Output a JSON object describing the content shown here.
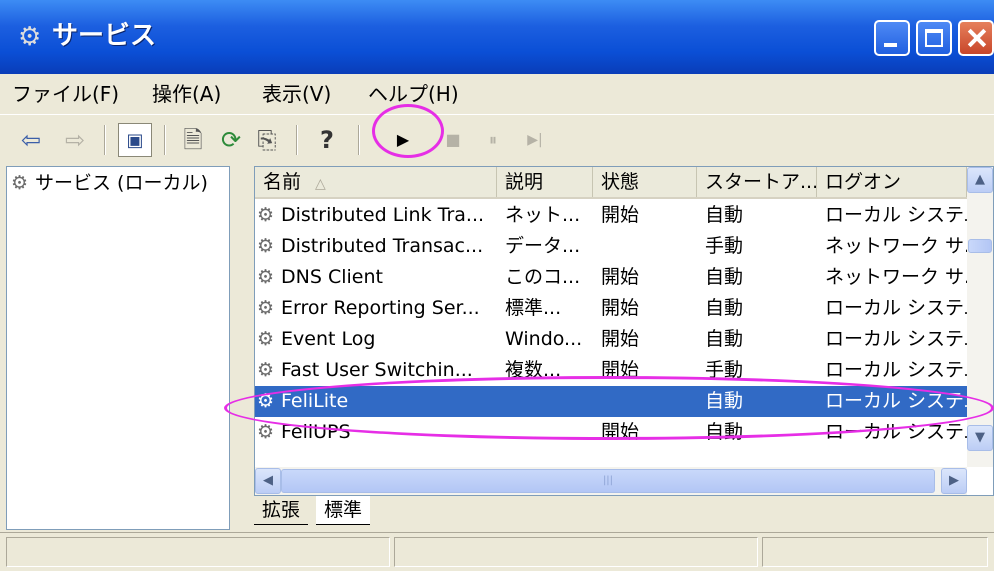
{
  "window": {
    "title": "サービス",
    "icon": "services-gear-icon"
  },
  "menu": [
    "ファイル(F)",
    "操作(A)",
    "表示(V)",
    "ヘルプ(H)"
  ],
  "toolbar": {
    "buttons": [
      "back-arrow-icon",
      "forward-arrow-icon",
      "show-hide-tree-icon",
      "properties-icon",
      "refresh-icon",
      "export-list-icon",
      "help-icon",
      "start-service-icon",
      "stop-service-icon",
      "pause-service-icon",
      "restart-service-icon"
    ],
    "glyphs": {
      "back": "⇦",
      "forward": "⇨",
      "tree": "▣",
      "props": "🗎",
      "refresh": "⟳",
      "export": "⎘",
      "help": "?",
      "play": "▶",
      "stop": "■",
      "pause": "⏸",
      "restart": "▶|"
    }
  },
  "tree": {
    "root": "サービス (ローカル)"
  },
  "list": {
    "headers": [
      "名前",
      "説明",
      "状態",
      "スタートア...",
      "ログオン"
    ],
    "rows": [
      {
        "name": "Distributed Link Tra...",
        "desc": "ネット...",
        "status": "開始",
        "startup": "自動",
        "logon": "ローカル システム"
      },
      {
        "name": "Distributed Transac...",
        "desc": "データ...",
        "status": "",
        "startup": "手動",
        "logon": "ネットワーク サ..."
      },
      {
        "name": "DNS Client",
        "desc": "このコ...",
        "status": "開始",
        "startup": "自動",
        "logon": "ネットワーク サ..."
      },
      {
        "name": "Error Reporting Ser...",
        "desc": "標準...",
        "status": "開始",
        "startup": "自動",
        "logon": "ローカル システム"
      },
      {
        "name": "Event Log",
        "desc": "Windo...",
        "status": "開始",
        "startup": "自動",
        "logon": "ローカル システム"
      },
      {
        "name": "Fast User Switchin...",
        "desc": "複数...",
        "status": "開始",
        "startup": "手動",
        "logon": "ローカル システム"
      },
      {
        "name": "FeliLite",
        "desc": "",
        "status": "",
        "startup": "自動",
        "logon": "ローカル システム"
      },
      {
        "name": "FeliUPS",
        "desc": "",
        "status": "開始",
        "startup": "自動",
        "logon": "ローカル システム"
      }
    ],
    "selected_row": 6
  },
  "tabs": [
    "拡張",
    "標準"
  ],
  "active_tab": "標準",
  "colors": {
    "selection": "#316ac5",
    "annotation": "#e62ee6",
    "titlebar": "#0b4fd6"
  }
}
